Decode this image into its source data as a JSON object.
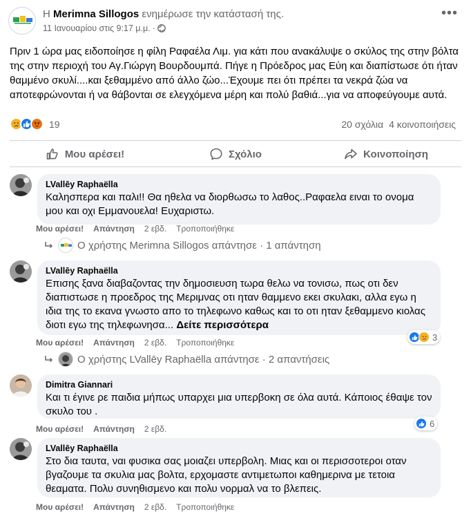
{
  "post": {
    "author_prefix": "Η",
    "author": "Merimna Sillogos",
    "action": "ενημέρωσε την κατάστασή της.",
    "timestamp": "11 Ιανουαρίου στις 9:17 μ.μ.",
    "dot": "·",
    "text": "Πριν 1 ώρα μας ειδοποίησε η φίλη Ραφαέλα Λιμ. για κάτι που ανακάλυψε ο σκύλος της στην βόλτα της στην περιοχή του Αγ.Γιώργη Βουρδουμπά. Πήγε η Πρόεδρος μας Εύη και διαπίστωσε ότι ήταν θαμμένο σκυλί....και ξεθαμμένο από άλλο ζώο...Έχουμε πει ότι πρέπει τα νεκρά ζώα  να αποτεφρώνονται ή να θάβονται σε ελεγχόμενα μέρη και πολύ βαθιά...για να αποφεύγουμε αυτά.",
    "reaction_count": "19",
    "comments_count": "20 σχόλια",
    "shares_count": "4 κοινοποιήσεις"
  },
  "actions": {
    "like": "Μου αρέσει!",
    "comment": "Σχόλιο",
    "share": "Κοινοποίηση"
  },
  "colors": {
    "like_blue": "#1877f2",
    "sad_yellow": "#f7b125",
    "angry_orange": "#e9710f",
    "bubble_bg": "#f0f2f5",
    "secondary_text": "#65676b"
  },
  "comments": [
    {
      "name": "LVallēy Raphaëlla",
      "text": "Καλησπερα και παλι!! Θα ηθελα να διορθωσω το λαθος..Ραφαελα ειναι το ονομα μου και οχι Εμμανουελα! Ευχαριστω.",
      "like": "Μου αρέσει!",
      "reply": "Απάντηση",
      "time": "2 εβδ.",
      "edited": "Τροποποιήθηκε",
      "replies": "Ο χρήστης Merimna Sillogos απάντησε · 1 απάντηση"
    },
    {
      "name": "LVallēy Raphaëlla",
      "text": "Επισης ξανα διαβαζοντας την δημοσιευση τωρα θελω να τονισω, πως οτι δεν διαπιστωσε η προεδρος της Μεριμνας οτι ηταν θαμμενο εκει σκυλακι, αλλα εγω η ιδια της το εκανα γνωστο απο το τηλεφωνο καθως και το οτι ηταν ξεθαμμενο κιολας διοτι εγω της τηλεφωνησα...",
      "see_more": "Δείτε περισσότερα",
      "like": "Μου αρέσει!",
      "reply": "Απάντηση",
      "time": "2 εβδ.",
      "edited": "Τροποποιήθηκε",
      "reactions": "3",
      "replies": "Ο χρήστης LVallēy Raphaëlla απάντησε · 2 απαντήσεις"
    },
    {
      "name": "Dimitra Giannari",
      "text": "Και τι έγινε ρε παιδια μήπως υπαρχει μια υπερβοκη σε όλα αυτά. Κάποιος έθαψε τον σκυλο του .",
      "like": "Μου αρέσει!",
      "reply": "Απάντηση",
      "time": "2 εβδ.",
      "reactions": "6"
    },
    {
      "name": "LVallēy Raphaëlla",
      "text": "Στο δια ταυτα, ναι φυσικα σας μοιαζει υπερβολη. Μιας και οι περισσοτεροι οταν βγαζουμε τα σκυλια μας βολτα, ερχομαστε αντιμετωποι καθημερινα με τετοια θεαματα. Πολυ συνηθισμενο και πολυ νορμαλ να το βλεπεις.",
      "like": "Μου αρέσει!",
      "reply": "Απάντηση",
      "time": "2 εβδ.",
      "edited": "Τροποποιήθηκε"
    }
  ]
}
